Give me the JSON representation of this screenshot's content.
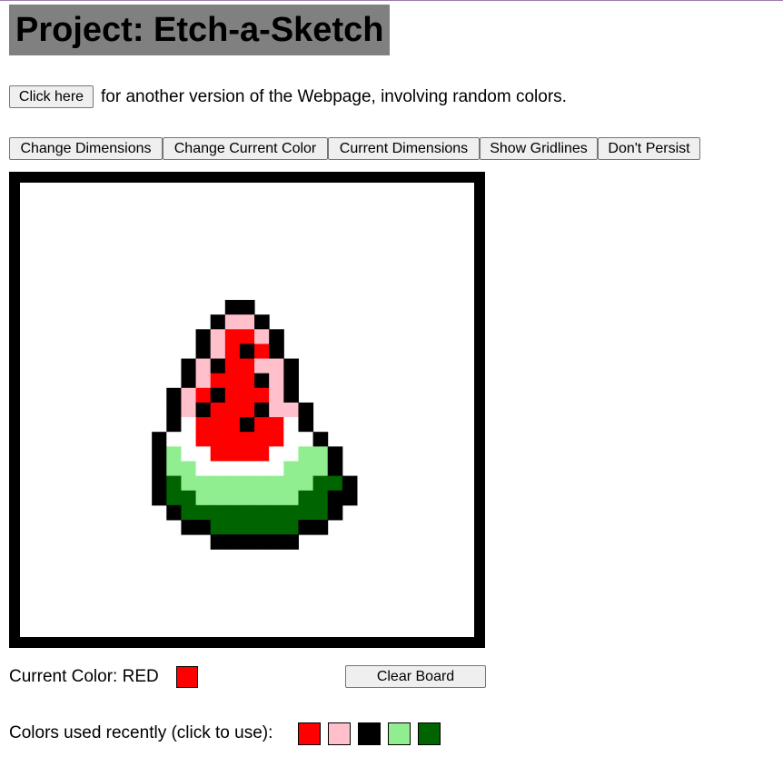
{
  "page": {
    "title": "Project: Etch-a-Sketch"
  },
  "intro": {
    "button_label": "Click here",
    "text": "for another version of the Webpage, involving random colors."
  },
  "toolbar": {
    "change_dimensions": "Change Dimensions",
    "change_current_color": "Change Current Color",
    "current_dimensions": "Current Dimensions",
    "show_gridlines": "Show Gridlines",
    "dont_persist": "Don't Persist"
  },
  "board": {
    "grid_size": 31,
    "palette": {
      "K": "#000000",
      "R": "#ff0000",
      "P": "#ffc0cb",
      "W": "#ffffff",
      "L": "#90ee90",
      "G": "#006400"
    },
    "pixels": [
      "...............................",
      "...............................",
      "...............................",
      "...............................",
      "...............................",
      "...............................",
      "...............................",
      "...............................",
      "..............KK...............",
      ".............KPPK..............",
      "............KPRRPK.............",
      "............KPRKRK.............",
      "...........KPKRRPPK............",
      "...........KPRRRKPK............",
      "..........KPRKRRRPK............",
      "..........KPKRRRKPPK...........",
      "..........KWRRRKRRWK...........",
      ".........KWWRRRRRRWWK..........",
      ".........KLWWRRRRWWLLK.........",
      ".........KLLWWWWWWLLLK.........",
      ".........KGLLLLLLLLLGGK........",
      ".........KGGLLLLLLLGGKK........",
      "..........KGGGGGGGGGGK.........",
      "...........KKGGGGGGKK..........",
      ".............KKKKKK............",
      "...............................",
      "...............................",
      "...............................",
      "...............................",
      "...............................",
      "..............................."
    ]
  },
  "controls": {
    "current_color_label": "Current Color: RED",
    "current_color": "#ff0000",
    "clear_board": "Clear Board",
    "recent_label": "Colors used recently (click to use):",
    "recent_colors": [
      "#ff0000",
      "#ffc0cb",
      "#000000",
      "#90ee90",
      "#006400"
    ]
  }
}
